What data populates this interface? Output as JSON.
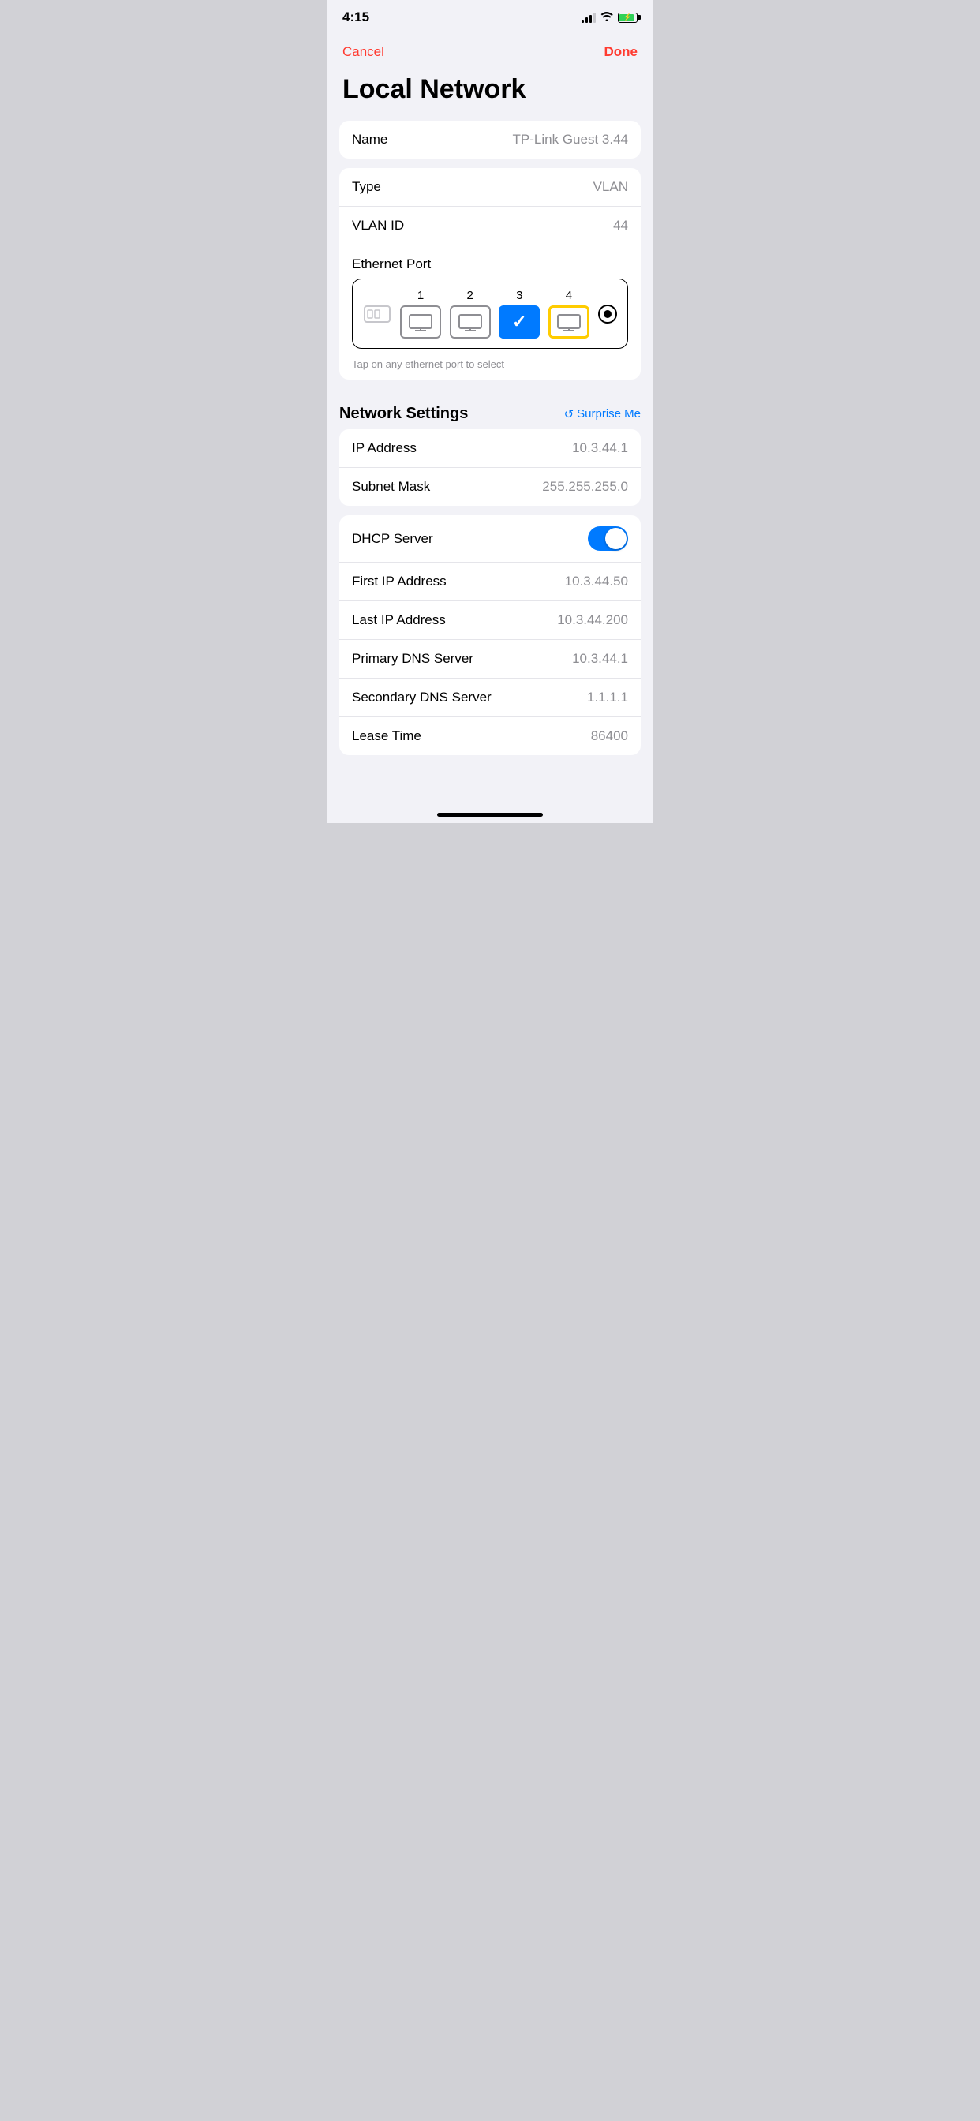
{
  "statusBar": {
    "time": "4:15",
    "signalBars": 3,
    "battery": 85
  },
  "nav": {
    "cancelLabel": "Cancel",
    "doneLabel": "Done"
  },
  "pageTitle": "Local Network",
  "nameSection": {
    "label": "Name",
    "value": "TP-Link Guest 3.44"
  },
  "typeSection": {
    "typeLabel": "Type",
    "typeValue": "VLAN",
    "vlanIdLabel": "VLAN ID",
    "vlanIdValue": "44",
    "ethernetPortLabel": "Ethernet Port",
    "ethernetHint": "Tap on any ethernet port to select",
    "ports": [
      {
        "number": "1",
        "state": "normal"
      },
      {
        "number": "2",
        "state": "normal"
      },
      {
        "number": "3",
        "state": "selected"
      },
      {
        "number": "4",
        "state": "highlighted"
      }
    ]
  },
  "networkSettings": {
    "title": "Network Settings",
    "surpriseMeLabel": "Surprise Me",
    "rows": [
      {
        "label": "IP Address",
        "value": "10.3.44.1"
      },
      {
        "label": "Subnet Mask",
        "value": "255.255.255.0"
      }
    ]
  },
  "dhcpSection": {
    "rows": [
      {
        "label": "DHCP Server",
        "type": "toggle",
        "value": true
      },
      {
        "label": "First IP Address",
        "value": "10.3.44.50"
      },
      {
        "label": "Last IP Address",
        "value": "10.3.44.200"
      },
      {
        "label": "Primary DNS Server",
        "value": "10.3.44.1"
      },
      {
        "label": "Secondary DNS Server",
        "value": "1.1.1.1"
      },
      {
        "label": "Lease Time",
        "value": "86400"
      }
    ]
  }
}
